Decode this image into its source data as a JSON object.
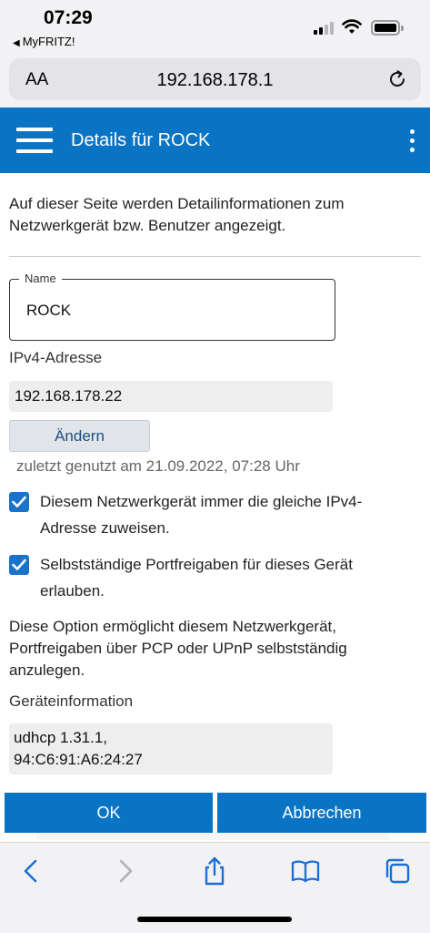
{
  "status_bar": {
    "time": "07:29",
    "back_app": "MyFRITZ!"
  },
  "browser": {
    "text_size_label": "AA",
    "url": "192.168.178.1",
    "reload_icon": "reload-icon"
  },
  "header": {
    "title": "Details für ROCK",
    "menu_icon": "hamburger-icon",
    "more_icon": "more-vertical-icon"
  },
  "content": {
    "intro": "Auf dieser Seite werden Detailinformationen zum Netzwerkgerät bzw. Benutzer angezeigt.",
    "name_label": "Name",
    "name_value": "ROCK",
    "ipv4_label": "IPv4-Adresse",
    "ipv4_value": "192.168.178.22",
    "change_button": "Ändern",
    "last_used": "zuletzt genutzt am 21.09.2022, 07:28 Uhr",
    "checkbox_same_ip": {
      "label": "Diesem Netzwerkgerät immer die gleiche IPv4-Adresse zuweisen.",
      "checked": true
    },
    "checkbox_portfw": {
      "label": "Selbstständige Portfreigaben für dieses Gerät erlauben.",
      "checked": true
    },
    "portfw_description": "Diese Option ermöglicht diesem Netzwerkgerät, Portfreigaben über PCP oder UPnP selbstständig anzulegen.",
    "device_info_label": "Geräteinformation",
    "device_info_line1": "udhcp 1.31.1,",
    "device_info_line2": "94:C6:91:A6:24:27"
  },
  "actions": {
    "ok": "OK",
    "cancel": "Abbrechen"
  },
  "colors": {
    "accent": "#0a74c4",
    "checkbox": "#1a73c9",
    "toolbar_icon": "#1b6fd8"
  },
  "toolbar": {
    "icons": [
      "back-icon",
      "forward-icon",
      "share-icon",
      "bookmarks-icon",
      "tabs-icon"
    ]
  }
}
